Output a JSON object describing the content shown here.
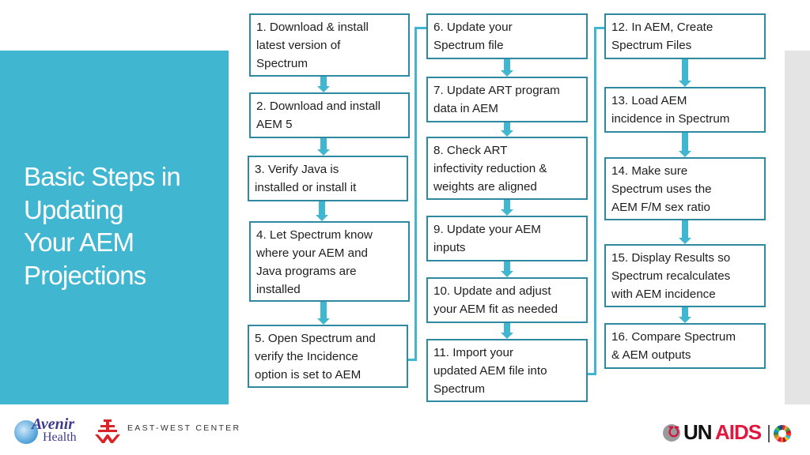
{
  "title": "Basic Steps in Updating Your AEM Projections",
  "title_lines": [
    "Basic Steps in",
    "Updating",
    "Your AEM",
    "Projections"
  ],
  "colors": {
    "panel": "#41b6d1",
    "box_border": "#2d8aa0",
    "arrow": "#41b6d1",
    "side_strip": "#e4e4e4"
  },
  "columns": [
    {
      "steps": [
        {
          "number": 1,
          "lines": [
            "1. Download & install",
            "latest version of",
            "Spectrum"
          ]
        },
        {
          "number": 2,
          "lines": [
            "2. Download and install",
            "AEM 5"
          ]
        },
        {
          "number": 3,
          "lines": [
            "3. Verify Java is",
            "installed or install it"
          ]
        },
        {
          "number": 4,
          "lines": [
            "4. Let Spectrum know",
            "where your AEM and",
            "Java programs are",
            "installed"
          ]
        },
        {
          "number": 5,
          "lines": [
            "5. Open Spectrum and",
            "verify the Incidence",
            "option is set to AEM"
          ]
        }
      ]
    },
    {
      "steps": [
        {
          "number": 6,
          "lines": [
            "6. Update your",
            "Spectrum file"
          ]
        },
        {
          "number": 7,
          "lines": [
            "7. Update ART program",
            "data in AEM"
          ]
        },
        {
          "number": 8,
          "lines": [
            "8. Check ART",
            "infectivity reduction &",
            "weights are aligned"
          ]
        },
        {
          "number": 9,
          "lines": [
            "9. Update your AEM",
            "inputs"
          ]
        },
        {
          "number": 10,
          "lines": [
            "10. Update and adjust",
            "your AEM fit as needed"
          ]
        },
        {
          "number": 11,
          "lines": [
            "11. Import your",
            "updated AEM file into",
            "Spectrum"
          ]
        }
      ]
    },
    {
      "steps": [
        {
          "number": 12,
          "lines": [
            "12. In AEM, Create",
            "Spectrum Files"
          ]
        },
        {
          "number": 13,
          "lines": [
            "13. Load AEM",
            "incidence in Spectrum"
          ]
        },
        {
          "number": 14,
          "lines": [
            "14. Make sure",
            "Spectrum uses the",
            "AEM F/M sex ratio"
          ]
        },
        {
          "number": 15,
          "lines": [
            "15. Display Results so",
            "Spectrum recalculates",
            "with AEM incidence"
          ]
        },
        {
          "number": 16,
          "lines": [
            "16. Compare Spectrum",
            "& AEM outputs"
          ]
        }
      ]
    }
  ],
  "connections": [
    {
      "from": 1,
      "to": 2
    },
    {
      "from": 2,
      "to": 3
    },
    {
      "from": 3,
      "to": 4
    },
    {
      "from": 4,
      "to": 5
    },
    {
      "from": 5,
      "to": 6
    },
    {
      "from": 6,
      "to": 7
    },
    {
      "from": 7,
      "to": 8
    },
    {
      "from": 8,
      "to": 9
    },
    {
      "from": 9,
      "to": 10
    },
    {
      "from": 10,
      "to": 11
    },
    {
      "from": 11,
      "to": 12
    },
    {
      "from": 12,
      "to": 13
    },
    {
      "from": 13,
      "to": 14
    },
    {
      "from": 14,
      "to": 15
    },
    {
      "from": 15,
      "to": 16
    }
  ],
  "logos": {
    "avenir": {
      "line1": "Avenir",
      "line2": "Health"
    },
    "ewc": {
      "text": "EAST-WEST CENTER"
    },
    "unaids": {
      "part1": "UN",
      "part2": "AIDS"
    }
  }
}
